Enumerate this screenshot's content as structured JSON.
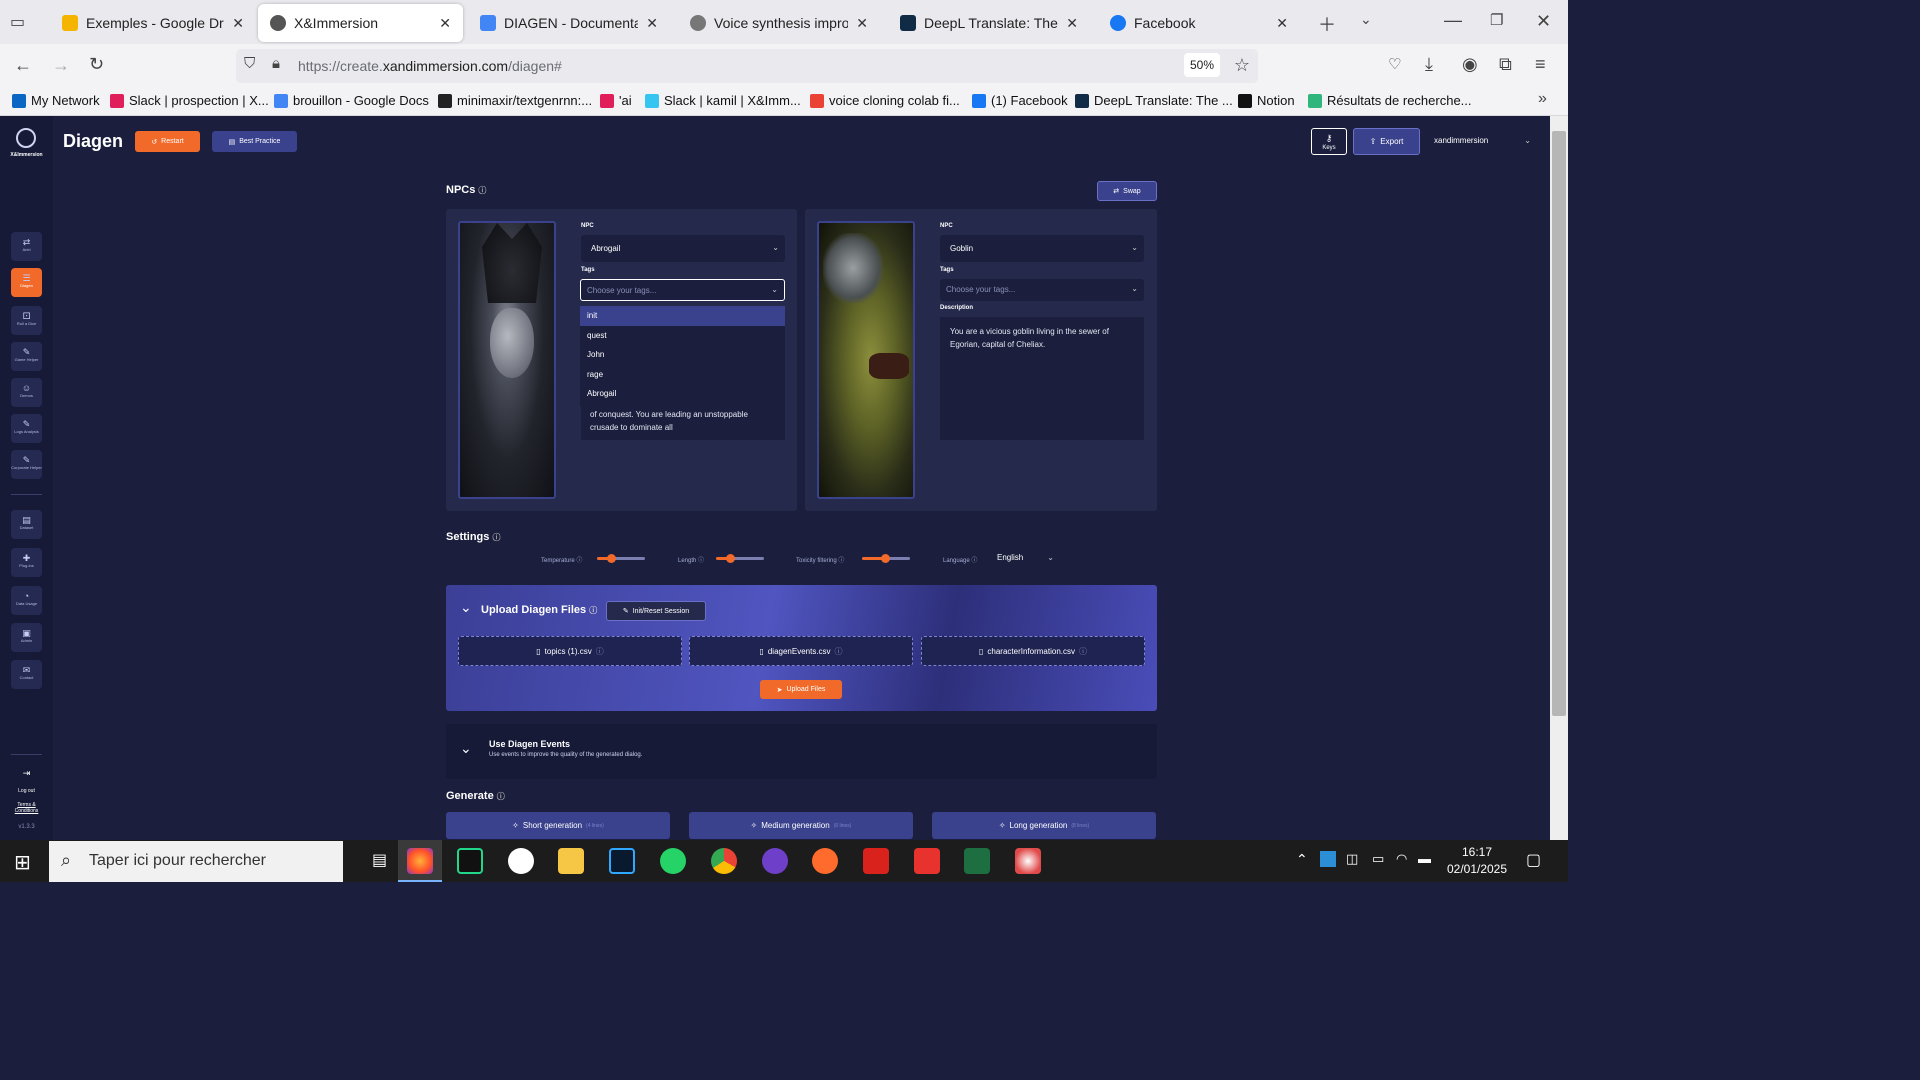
{
  "browser": {
    "tabs": [
      {
        "label": "Exemples - Google Drive",
        "color": "#f4b400"
      },
      {
        "label": "X&Immersion",
        "color": "#333333"
      },
      {
        "label": "DIAGEN - Documentation -",
        "color": "#4285f4"
      },
      {
        "label": "Voice synthesis improvemer",
        "color": "#444444"
      },
      {
        "label": "DeepL Translate: The world",
        "color": "#0f2b46"
      },
      {
        "label": "Facebook",
        "color": "#1877f2"
      }
    ],
    "url_prefix": "https://create.",
    "url_domain": "xandimmersion.com",
    "url_path": "/diagen#",
    "zoom": "50%",
    "bookmarks": [
      {
        "label": "My Network",
        "color": "#0a66c2"
      },
      {
        "label": "Slack | prospection | X...",
        "color": "#e01e5a"
      },
      {
        "label": "brouillon - Google Docs",
        "color": "#4285f4"
      },
      {
        "label": "minimaxir/textgenrnn:...",
        "color": "#222222"
      },
      {
        "label": "'ai",
        "color": "#e01e5a"
      },
      {
        "label": "Slack | kamil | X&Imm...",
        "color": "#36c5f0"
      },
      {
        "label": "voice cloning colab fi...",
        "color": "#ea4335"
      },
      {
        "label": "(1) Facebook",
        "color": "#1877f2"
      },
      {
        "label": "DeepL Translate: The ...",
        "color": "#0f2b46"
      },
      {
        "label": "Notion",
        "color": "#111111"
      },
      {
        "label": "Résultats de recherche...",
        "color": "#2eb67d"
      }
    ]
  },
  "app": {
    "logo_text": "X&Immersion",
    "title": "Diagen",
    "restart": "Restart",
    "best_practice": "Best Practice",
    "keys": "Keys",
    "export": "Export",
    "account": "xandimmersion",
    "version": "v1.3.3",
    "sidebar": [
      {
        "label": "Ariel",
        "glyph": "⇄"
      },
      {
        "label": "Diagen",
        "glyph": "☰"
      },
      {
        "label": "Roll a Dice",
        "glyph": "⚀"
      },
      {
        "label": "Game Helper",
        "glyph": "✎"
      },
      {
        "label": "Demos",
        "glyph": "☺"
      },
      {
        "label": "Logs Analysis",
        "glyph": "✎"
      },
      {
        "label": "Corporate Helper",
        "glyph": "✎"
      },
      {
        "label": "Dataset",
        "glyph": "▤"
      },
      {
        "label": "Plug-ins",
        "glyph": "✚"
      },
      {
        "label": "Data Usage",
        "glyph": "◔"
      },
      {
        "label": "Admin",
        "glyph": "▣"
      },
      {
        "label": "Contact",
        "glyph": "✉"
      }
    ],
    "logout": "Log out",
    "terms": "Terms & Conditions"
  },
  "npcs": {
    "title": "NPCs",
    "swap": "Swap",
    "left": {
      "npc_label": "NPC",
      "npc_value": "Abrogail",
      "tags_label": "Tags",
      "tags_placeholder": "Choose your tags...",
      "dropdown": [
        "init",
        "quest",
        "John",
        "rage",
        "Abrogail"
      ],
      "description_visible": "of conquest. You are leading an unstoppable crusade to dominate all"
    },
    "right": {
      "npc_label": "NPC",
      "npc_value": "Goblin",
      "tags_label": "Tags",
      "tags_placeholder": "Choose your tags...",
      "description_label": "Description",
      "description": "You are a vicious goblin living in the sewer of Egorian, capital of Cheliax."
    }
  },
  "settings": {
    "title": "Settings",
    "temperature": "Temperature",
    "length": "Length",
    "toxicity": "Toxicity filtering",
    "language_label": "Language",
    "language": "English"
  },
  "upload": {
    "title": "Upload Diagen Files",
    "init_reset": "Init/Reset Session",
    "files": [
      "topics (1).csv",
      "diagenEvents.csv",
      "characterInformation.csv"
    ],
    "upload_button": "Upload Files"
  },
  "events": {
    "title": "Use Diagen Events",
    "subtitle": "Use events to improve the quality of the generated dialog."
  },
  "generate": {
    "title": "Generate",
    "buttons": [
      {
        "label": "Short generation",
        "sub": "(4 lines)"
      },
      {
        "label": "Medium generation",
        "sub": "(6 lines)"
      },
      {
        "label": "Long generation",
        "sub": "(8 lines)"
      }
    ]
  },
  "taskbar": {
    "search_placeholder": "Taper ici pour rechercher",
    "time": "16:17",
    "date": "02/01/2025"
  }
}
